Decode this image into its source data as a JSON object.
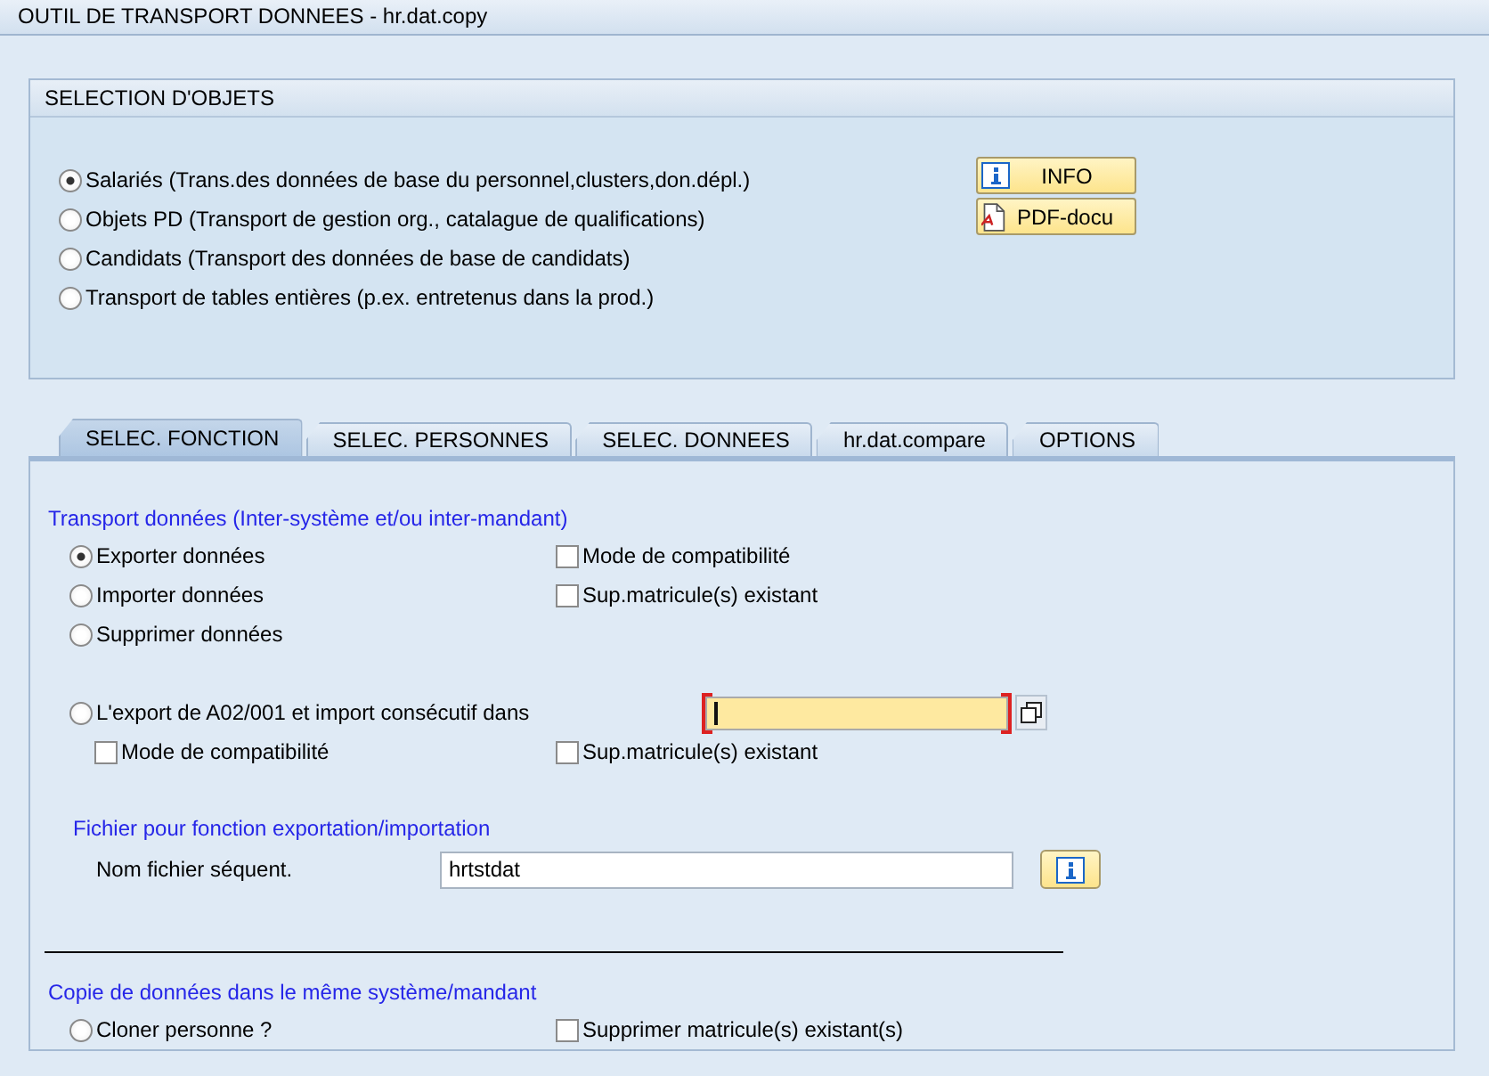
{
  "window": {
    "title": "OUTIL DE TRANSPORT DONNEES - hr.dat.copy"
  },
  "object_selection": {
    "title": "SELECTION D'OBJETS",
    "options": [
      {
        "label": "Salariés (Trans.des données de base du personnel,clusters,don.dépl.)",
        "selected": true
      },
      {
        "label": "Objets PD (Transport de gestion org., catalague de qualifications)",
        "selected": false
      },
      {
        "label": "Candidats (Transport des données de base de candidats)",
        "selected": false
      },
      {
        "label": "Transport de tables entières (p.ex. entretenus dans la prod.)",
        "selected": false
      }
    ],
    "buttons": [
      {
        "label": "INFO",
        "kind": "info"
      },
      {
        "label": "PDF-docu",
        "kind": "pdf"
      }
    ]
  },
  "tabs": [
    {
      "label": "SELEC. FONCTION",
      "selected": true
    },
    {
      "label": "SELEC. PERSONNES",
      "selected": false
    },
    {
      "label": "SELEC. DONNEES",
      "selected": false
    },
    {
      "label": "hr.dat.compare",
      "selected": false
    },
    {
      "label": "OPTIONS",
      "selected": false
    }
  ],
  "transport": {
    "title": "Transport données (Inter-système et/ou inter-mandant)",
    "rows": [
      {
        "radio": {
          "label": "Exporter données",
          "selected": true
        },
        "checkbox": {
          "label": "Mode de compatibilité",
          "checked": false
        }
      },
      {
        "radio": {
          "label": "Importer données",
          "selected": false
        },
        "checkbox": {
          "label": "Sup.matricule(s) existant",
          "checked": false
        }
      },
      {
        "radio": {
          "label": "Supprimer données",
          "selected": false
        }
      }
    ],
    "export_import": {
      "radio": {
        "label": "L'export de A02/001 et import consécutif dans",
        "selected": false
      },
      "checkboxes": [
        {
          "label": "Mode de compatibilité",
          "checked": false
        },
        {
          "label": "Sup.matricule(s) existant",
          "checked": false
        }
      ]
    }
  },
  "file": {
    "title": "Fichier pour fonction exportation/importation",
    "label": "Nom fichier séquent.",
    "value": "hrtstdat"
  },
  "copy": {
    "title": "Copie de données dans le même système/mandant",
    "radio": {
      "label": "Cloner personne ?",
      "selected": false
    },
    "checkbox": {
      "label": "Supprimer matricule(s) existant(s)",
      "checked": false
    }
  }
}
